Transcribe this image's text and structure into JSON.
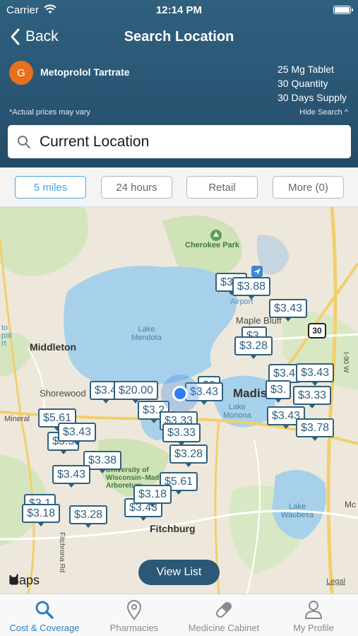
{
  "status": {
    "carrier": "Carrier",
    "time": "12:14 PM"
  },
  "nav": {
    "back": "Back",
    "title": "Search Location"
  },
  "drug": {
    "avatar_letter": "G",
    "name": "Metoprolol Tartrate",
    "dose": "25 Mg Tablet",
    "quantity": "30 Quantity",
    "supply": "30 Days Supply",
    "disclaimer": "*Actual prices may vary",
    "hide_search": "Hide Search ^"
  },
  "search": {
    "value": "Current Location"
  },
  "filters": [
    "5 miles",
    "24 hours",
    "Retail",
    "More (0)"
  ],
  "map": {
    "labels": {
      "cherokee": "Cherokee Park",
      "middleton": "Middleton",
      "shorewood": "Shorewood",
      "mineral": "Mineral",
      "lake_mendota": "Lake\nMendota",
      "lake_monona": "Lake\nMonona",
      "lake_waubesa": "Lake\nWaubesa",
      "maple_bluff": "Maple Bluff",
      "madison": "Madison",
      "fitchburg": "Fitchburg",
      "univ": "University of\nWisconsin–Madison\nArboretum",
      "airport": "Airport",
      "i90": "I-90 W",
      "fitchrona": "Fitchrona Rd",
      "mc": "Mc",
      "to_pal": "to\npal\nrt"
    },
    "pins": [
      "$3.88",
      "$3.43",
      "$3.28",
      "$3.43",
      "$3.33",
      "$3.43",
      "$3.78",
      "$3.43",
      "$20.00",
      "$3.43",
      "$3.33",
      "$3.33",
      "$3.28",
      "$5.61",
      "$3.43",
      "$3.38",
      "$3.43",
      "$5.61",
      "$3.18",
      "$3.18",
      "$3.28"
    ],
    "shield": "30",
    "view_list": "View List",
    "maps_brand": "Maps",
    "legal": "Legal"
  },
  "tabs": [
    "Cost & Coverage",
    "Pharmacies",
    "Medicine Cabinet",
    "My Profile"
  ],
  "colors": {
    "header": "#2b5877",
    "accent": "#2f7fc1",
    "pin": "#2f607e",
    "avatar": "#e8701e"
  }
}
